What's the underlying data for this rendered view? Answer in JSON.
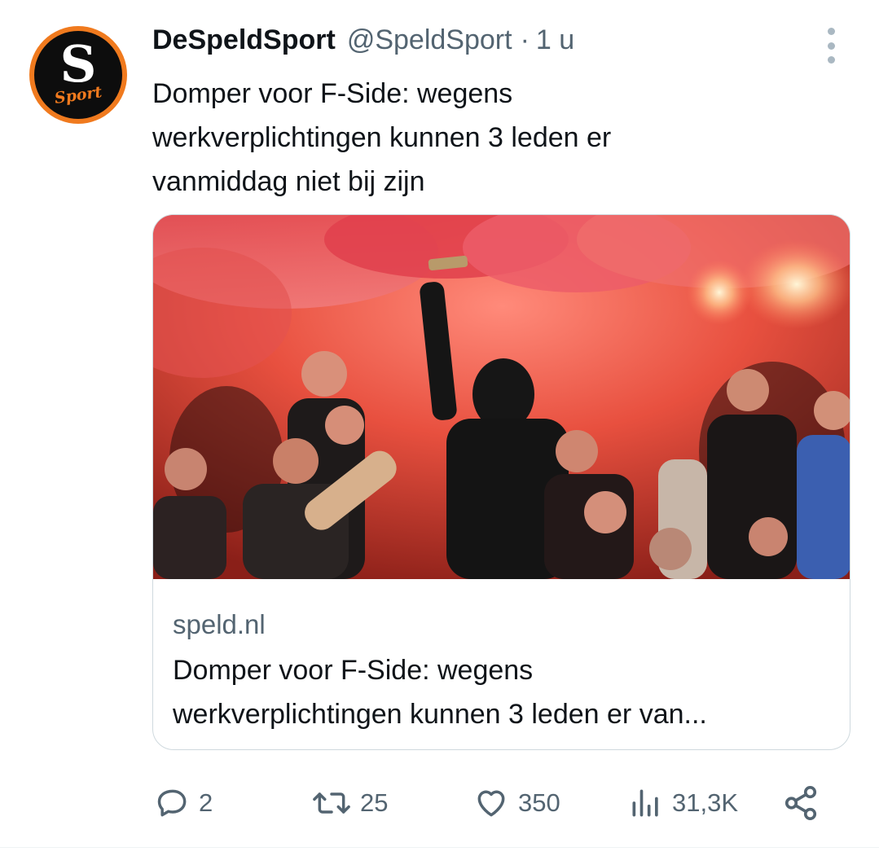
{
  "author": {
    "display_name": "DeSpeldSport",
    "handle": "@SpeldSport",
    "separator": "·",
    "time": "1 u",
    "avatar": {
      "letter": "S",
      "script": "Sport",
      "ring_color": "#f07a1e",
      "bg_color": "#0d0d0d"
    }
  },
  "tweet": {
    "lines": [
      "Domper voor F-Side: wegens",
      "werkverplichtingen kunnen 3 leden er",
      "vanmiddag niet bij zijn"
    ]
  },
  "card": {
    "domain": "speld.nl",
    "title_lines": [
      "Domper voor F-Side: wegens",
      "werkverplichtingen kunnen 3 leden er van..."
    ]
  },
  "actions": {
    "reply": {
      "icon": "reply-icon",
      "count": "2"
    },
    "retweet": {
      "icon": "retweet-icon",
      "count": "25"
    },
    "like": {
      "icon": "heart-icon",
      "count": "350"
    },
    "views": {
      "icon": "views-icon",
      "count": "31,3K"
    },
    "share": {
      "icon": "share-icon"
    }
  },
  "colors": {
    "text": "#0f1419",
    "secondary": "#536471",
    "border": "#cfd9de"
  }
}
